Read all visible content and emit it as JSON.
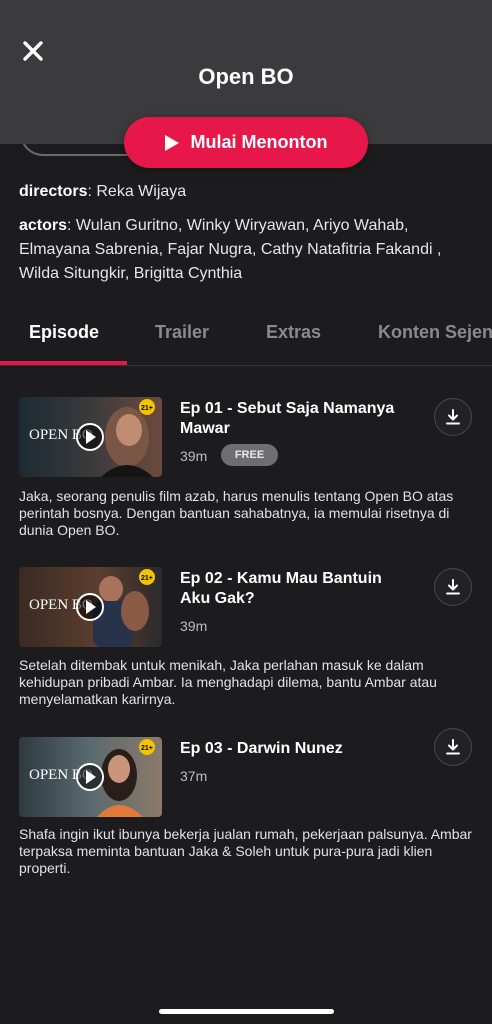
{
  "header": {
    "title": "Open BO",
    "close_icon": "close-icon"
  },
  "play_button": {
    "label": "Mulai Menonton",
    "accent": "#e8174a"
  },
  "credits": {
    "directors_label": "directors",
    "directors_value": "Reka Wijaya",
    "actors_label": "actors",
    "actors_value": "Wulan Guritno, Winky Wiryawan, Ariyo Wahab, Elmayana Sabrenia, Fajar Nugra, Cathy Natafitria Fakandi , Wilda Situngkir, Brigitta Cynthia"
  },
  "tabs": [
    {
      "label": "Episode",
      "active": true
    },
    {
      "label": "Trailer",
      "active": false
    },
    {
      "label": "Extras",
      "active": false
    },
    {
      "label": "Konten Sejenis",
      "active": false
    }
  ],
  "episodes": [
    {
      "title": "Ep 01 - Sebut Saja Namanya Mawar",
      "duration": "39m",
      "badge": "FREE",
      "description": "Jaka, seorang penulis film azab, harus menulis tentang Open BO atas perintah bosnya. Dengan bantuan sahabatnya, ia memulai risetnya di dunia Open BO.",
      "thumb_text": "OPEN BO",
      "rating": "21+"
    },
    {
      "title": "Ep 02 - Kamu Mau Bantuin Aku Gak?",
      "duration": "39m",
      "description": "Setelah ditembak untuk menikah, Jaka perlahan masuk ke dalam kehidupan pribadi Ambar. Ia menghadapi dilema, bantu Ambar atau menyelamatkan karirnya.",
      "thumb_text": "OPEN BO",
      "rating": "21+"
    },
    {
      "title": "Ep 03 - Darwin Nunez",
      "duration": "37m",
      "description": "Shafa ingin ikut ibunya bekerja jualan rumah, pekerjaan palsunya. Ambar terpaksa meminta bantuan Jaka & Soleh untuk pura-pura jadi klien properti.",
      "thumb_text": "OPEN BO",
      "rating": "21+"
    }
  ]
}
